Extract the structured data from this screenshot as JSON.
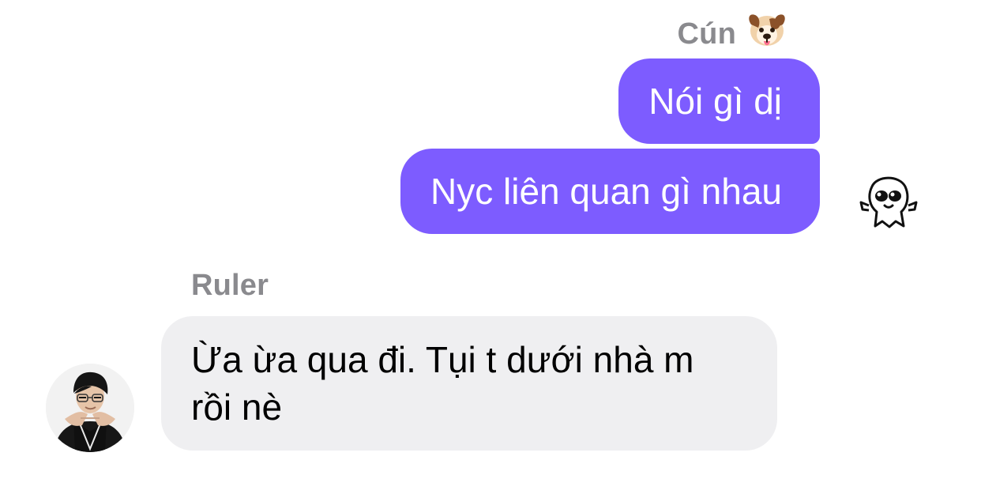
{
  "conversation": {
    "outgoing": {
      "sender_name": "Cún",
      "sender_emoji": "dog-face-icon",
      "messages": [
        "Nói gì dị",
        "Nyc liên quan gì nhau"
      ],
      "bubble_color": "#7d5cff",
      "seen_indicator": "ghost-sticker-icon"
    },
    "incoming": {
      "sender_name": "Ruler",
      "messages": [
        {
          "lines": [
            "Ừa ừa qua đi. Tụi t dưới nhà m",
            "rồi nè"
          ]
        }
      ],
      "bubble_color": "#efeff1"
    }
  }
}
